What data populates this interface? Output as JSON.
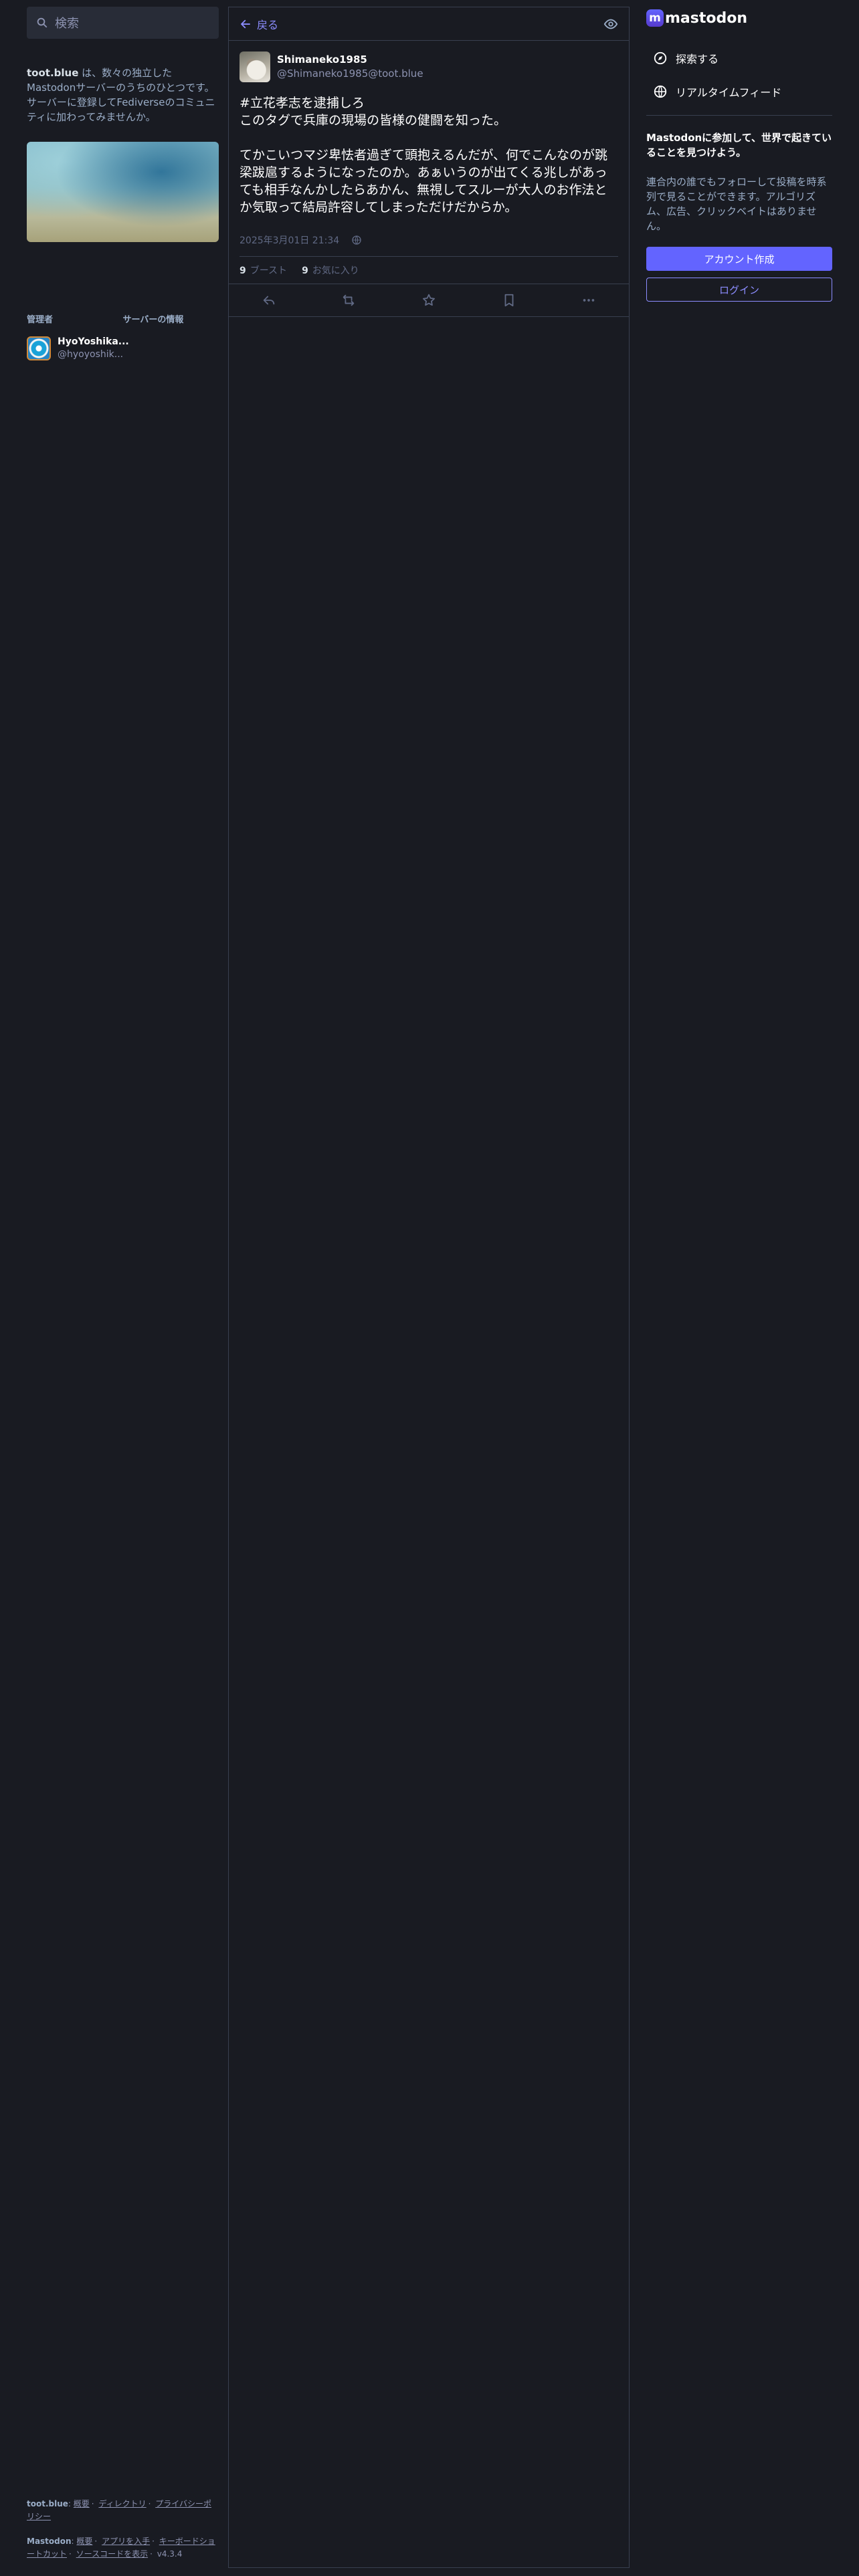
{
  "search": {
    "placeholder": "検索"
  },
  "server_info": {
    "name": "toot.blue",
    "description": " は、数々の独立したMastodonサーバーのうちのひとつです。サーバーに登録してFediverseのコミュニティに加わってみませんか。"
  },
  "admin": {
    "label": "管理者",
    "server_info_label": "サーバーの情報",
    "name": "HyoYoshika...",
    "handle": "@hyoyoshik..."
  },
  "footer": {
    "server": "toot.blue",
    "links1": [
      "概要",
      "ディレクトリ",
      "プライバシーポリシー"
    ],
    "brand": "Mastodon",
    "links2": [
      "概要",
      "アプリを入手",
      "キーボードショートカット",
      "ソースコードを表示"
    ],
    "version": "v4.3.4"
  },
  "column": {
    "back_label": "戻る"
  },
  "status": {
    "display_name": "Shimaneko1985",
    "handle": "@Shimaneko1985@toot.blue",
    "paragraph1_line1": "#立花孝志を逮捕しろ",
    "paragraph1_line2": "このタグで兵庫の現場の皆様の健闘を知った。",
    "paragraph2": "てかこいつマジ卑怯者過ぎて頭抱えるんだが、何でこんなのが跳梁跋扈するようになったのか。あぁいうのが出てくる兆しがあっても相手なんかしたらあかん、無視してスルーが大人のお作法とか気取って結局許容してしまっただけだからか。",
    "timestamp": "2025年3月01日 21:34",
    "boosts_count": "9",
    "boosts_label": "ブースト",
    "favs_count": "9",
    "favs_label": "お気に入り"
  },
  "right": {
    "logo_text": "mastodon",
    "nav": [
      {
        "label": "探索する",
        "icon": "compass-icon"
      },
      {
        "label": "リアルタイムフィード",
        "icon": "globe-icon"
      }
    ],
    "signup_title": "Mastodonに参加して、世界で起きていることを見つけよう。",
    "signup_body": "連合内の誰でもフォローして投稿を時系列で見ることができます。アルゴリズム、広告、クリックベイトはありません。",
    "create_account": "アカウント作成",
    "login": "ログイン"
  },
  "colors": {
    "accent": "#6364ff",
    "link": "#8c8dff",
    "background": "#191b22"
  }
}
